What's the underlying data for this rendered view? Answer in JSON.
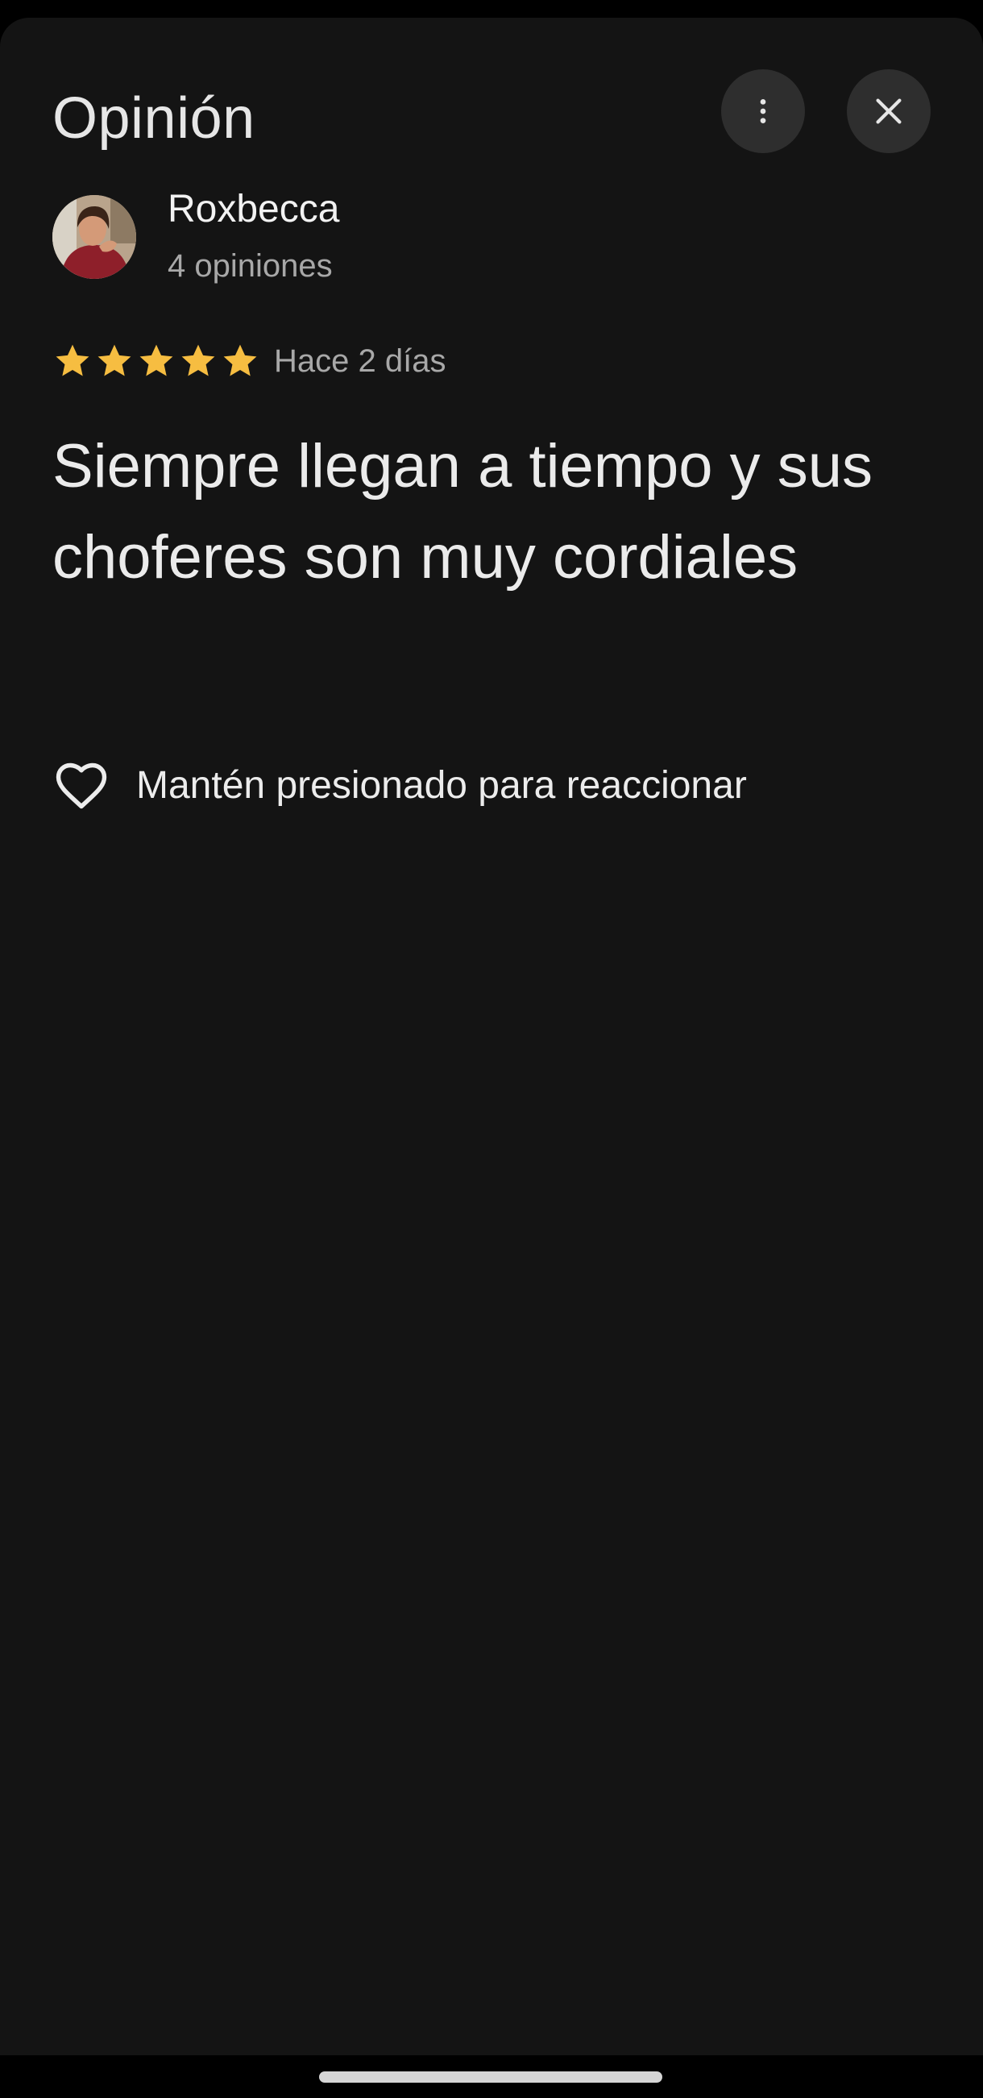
{
  "header": {
    "title": "Opinión",
    "more_icon": "more-vert-icon",
    "close_icon": "close-icon"
  },
  "author": {
    "name": "Roxbecca",
    "review_count": "4 opiniones"
  },
  "review": {
    "rating": 5,
    "rating_max": 5,
    "date": "Hace 2 días",
    "text": "Siempre llegan a tiempo y sus choferes son muy cordiales"
  },
  "reaction": {
    "icon": "heart-outline-icon",
    "label": "Mantén presionado para reaccionar"
  },
  "colors": {
    "star": "#f6bd41",
    "sheet_background": "#141414",
    "button_background": "#2e2e2e"
  }
}
